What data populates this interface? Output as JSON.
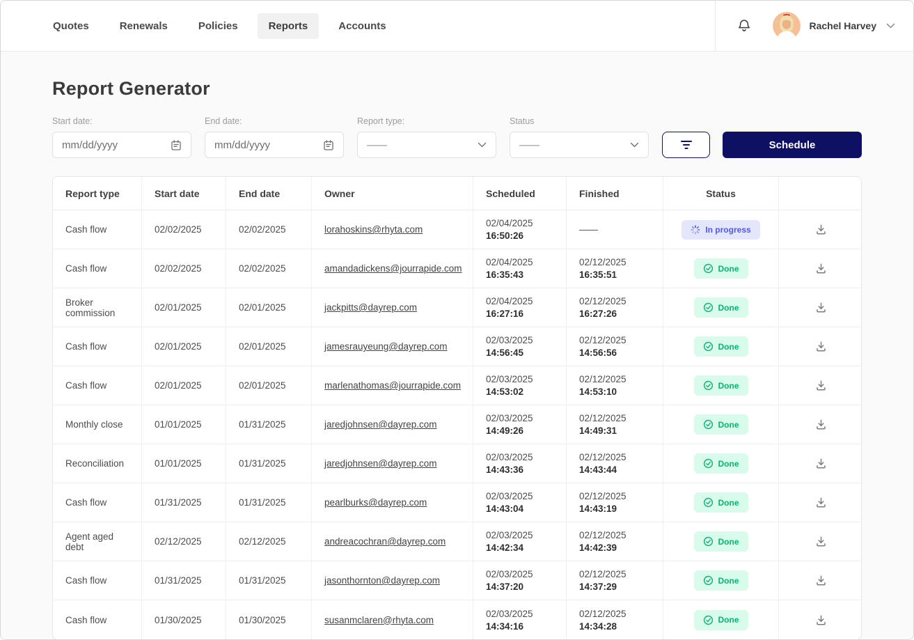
{
  "nav": {
    "items": [
      {
        "label": "Quotes",
        "active": false
      },
      {
        "label": "Renewals",
        "active": false
      },
      {
        "label": "Policies",
        "active": false
      },
      {
        "label": "Reports",
        "active": true
      },
      {
        "label": "Accounts",
        "active": false
      }
    ],
    "user_name": "Rachel Harvey"
  },
  "page_title": "Report Generator",
  "filters": {
    "start_date": {
      "label": "Start date:",
      "placeholder": "mm/dd/yyyy"
    },
    "end_date": {
      "label": "End date:",
      "placeholder": "mm/dd/yyyy"
    },
    "report_type": {
      "label": "Report type:",
      "value": "——"
    },
    "status": {
      "label": "Status",
      "value": "——"
    },
    "schedule_button": "Schedule"
  },
  "table": {
    "columns": [
      "Report type",
      "Start date",
      "End date",
      "Owner",
      "Scheduled",
      "Finished",
      "Status",
      ""
    ],
    "rows": [
      {
        "report_type": "Cash flow",
        "start_date": "02/02/2025",
        "end_date": "02/02/2025",
        "owner": "lorahoskins@rhyta.com",
        "scheduled_date": "02/04/2025",
        "scheduled_time": "16:50:26",
        "finished_date": "——",
        "finished_time": "",
        "status_label": "In progress",
        "status_type": "in_progress"
      },
      {
        "report_type": "Cash flow",
        "start_date": "02/02/2025",
        "end_date": "02/02/2025",
        "owner": "amandadickens@jourrapide.com",
        "scheduled_date": "02/04/2025",
        "scheduled_time": "16:35:43",
        "finished_date": "02/12/2025",
        "finished_time": "16:35:51",
        "status_label": "Done",
        "status_type": "done"
      },
      {
        "report_type": "Broker commission",
        "start_date": "02/01/2025",
        "end_date": "02/01/2025",
        "owner": "jackpitts@dayrep.com",
        "scheduled_date": "02/04/2025",
        "scheduled_time": "16:27:16",
        "finished_date": "02/12/2025",
        "finished_time": "16:27:26",
        "status_label": "Done",
        "status_type": "done"
      },
      {
        "report_type": "Cash flow",
        "start_date": "02/01/2025",
        "end_date": "02/01/2025",
        "owner": "jamesrauyeung@dayrep.com",
        "scheduled_date": "02/03/2025",
        "scheduled_time": "14:56:45",
        "finished_date": "02/12/2025",
        "finished_time": "14:56:56",
        "status_label": "Done",
        "status_type": "done"
      },
      {
        "report_type": "Cash flow",
        "start_date": "02/01/2025",
        "end_date": "02/01/2025",
        "owner": "marlenathomas@jourrapide.com",
        "scheduled_date": "02/03/2025",
        "scheduled_time": "14:53:02",
        "finished_date": "02/12/2025",
        "finished_time": "14:53:10",
        "status_label": "Done",
        "status_type": "done"
      },
      {
        "report_type": "Monthly close",
        "start_date": "01/01/2025",
        "end_date": "01/31/2025",
        "owner": "jaredjohnsen@dayrep.com",
        "scheduled_date": "02/03/2025",
        "scheduled_time": "14:49:26",
        "finished_date": "02/12/2025",
        "finished_time": "14:49:31",
        "status_label": "Done",
        "status_type": "done"
      },
      {
        "report_type": "Reconciliation",
        "start_date": "01/01/2025",
        "end_date": "01/31/2025",
        "owner": "jaredjohnsen@dayrep.com",
        "scheduled_date": "02/03/2025",
        "scheduled_time": "14:43:36",
        "finished_date": "02/12/2025",
        "finished_time": "14:43:44",
        "status_label": "Done",
        "status_type": "done"
      },
      {
        "report_type": "Cash flow",
        "start_date": "01/31/2025",
        "end_date": "01/31/2025",
        "owner": "pearlburks@dayrep.com",
        "scheduled_date": "02/03/2025",
        "scheduled_time": "14:43:04",
        "finished_date": "02/12/2025",
        "finished_time": "14:43:19",
        "status_label": "Done",
        "status_type": "done"
      },
      {
        "report_type": "Agent aged debt",
        "start_date": "02/12/2025",
        "end_date": "02/12/2025",
        "owner": "andreacochran@dayrep.com",
        "scheduled_date": "02/03/2025",
        "scheduled_time": "14:42:34",
        "finished_date": "02/12/2025",
        "finished_time": "14:42:39",
        "status_label": "Done",
        "status_type": "done"
      },
      {
        "report_type": "Cash flow",
        "start_date": "01/31/2025",
        "end_date": "01/31/2025",
        "owner": "jasonthornton@dayrep.com",
        "scheduled_date": "02/03/2025",
        "scheduled_time": "14:37:20",
        "finished_date": "02/12/2025",
        "finished_time": "14:37:29",
        "status_label": "Done",
        "status_type": "done"
      },
      {
        "report_type": "Cash flow",
        "start_date": "01/30/2025",
        "end_date": "01/30/2025",
        "owner": "susanmclaren@rhyta.com",
        "scheduled_date": "02/03/2025",
        "scheduled_time": "14:34:16",
        "finished_date": "02/12/2025",
        "finished_time": "14:34:28",
        "status_label": "Done",
        "status_type": "done"
      }
    ]
  },
  "colors": {
    "accent_navy": "#0e1063",
    "done_bg": "#d9fbec",
    "done_text": "#0cb473",
    "in_progress_bg": "#e4e6fc",
    "in_progress_text": "#5058e4"
  }
}
